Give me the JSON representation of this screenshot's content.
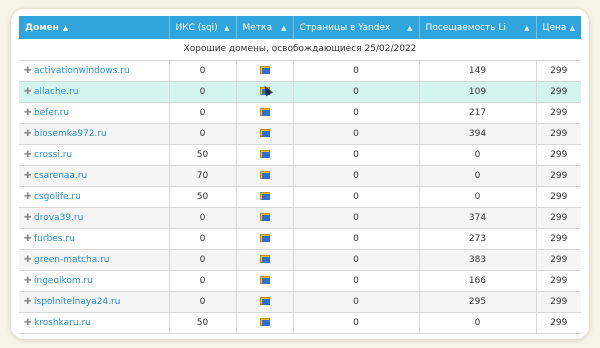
{
  "table": {
    "columns": [
      {
        "label": "Домен",
        "sort": "▲",
        "active": true
      },
      {
        "label": "ИКС (sqi)",
        "sort": "▲",
        "active": false
      },
      {
        "label": "Метка",
        "sort": "▲",
        "active": false
      },
      {
        "label": "Страницы в Yandex",
        "sort": "▲",
        "active": false
      },
      {
        "label": "Посещаемость Li",
        "sort": "▲",
        "active": false
      },
      {
        "label": "Цена",
        "sort": "▲",
        "active": false
      }
    ],
    "caption": "Хорошие домены, освобождающиеся 25/02/2022",
    "rows": [
      {
        "domain": "activationwindows.ru",
        "iks": "0",
        "pages": "0",
        "traffic": "149",
        "price": "299",
        "hover": false
      },
      {
        "domain": "allache.ru",
        "iks": "0",
        "pages": "0",
        "traffic": "109",
        "price": "299",
        "hover": true
      },
      {
        "domain": "befer.ru",
        "iks": "0",
        "pages": "0",
        "traffic": "217",
        "price": "299",
        "hover": false
      },
      {
        "domain": "biosemka972.ru",
        "iks": "0",
        "pages": "0",
        "traffic": "394",
        "price": "299",
        "hover": false
      },
      {
        "domain": "crossi.ru",
        "iks": "50",
        "pages": "0",
        "traffic": "0",
        "price": "299",
        "hover": false
      },
      {
        "domain": "csarenaa.ru",
        "iks": "70",
        "pages": "0",
        "traffic": "0",
        "price": "299",
        "hover": false
      },
      {
        "domain": "csgolife.ru",
        "iks": "50",
        "pages": "0",
        "traffic": "0",
        "price": "299",
        "hover": false
      },
      {
        "domain": "drova39.ru",
        "iks": "0",
        "pages": "0",
        "traffic": "374",
        "price": "299",
        "hover": false
      },
      {
        "domain": "furbes.ru",
        "iks": "0",
        "pages": "0",
        "traffic": "273",
        "price": "299",
        "hover": false
      },
      {
        "domain": "green-matcha.ru",
        "iks": "0",
        "pages": "0",
        "traffic": "383",
        "price": "299",
        "hover": false
      },
      {
        "domain": "ingeolkom.ru",
        "iks": "0",
        "pages": "0",
        "traffic": "166",
        "price": "299",
        "hover": false
      },
      {
        "domain": "ispolnitelnaya24.ru",
        "iks": "0",
        "pages": "0",
        "traffic": "295",
        "price": "299",
        "hover": false
      },
      {
        "domain": "kroshkaru.ru",
        "iks": "50",
        "pages": "0",
        "traffic": "0",
        "price": "299",
        "hover": false
      }
    ]
  },
  "icons": {
    "expand": "plus-icon",
    "mark": "flag-icon",
    "expand_glyph": "✚"
  },
  "colors": {
    "header_bg": "#2fa4dd",
    "link": "#2a8fd0",
    "hover_row": "#d4f5ee"
  }
}
